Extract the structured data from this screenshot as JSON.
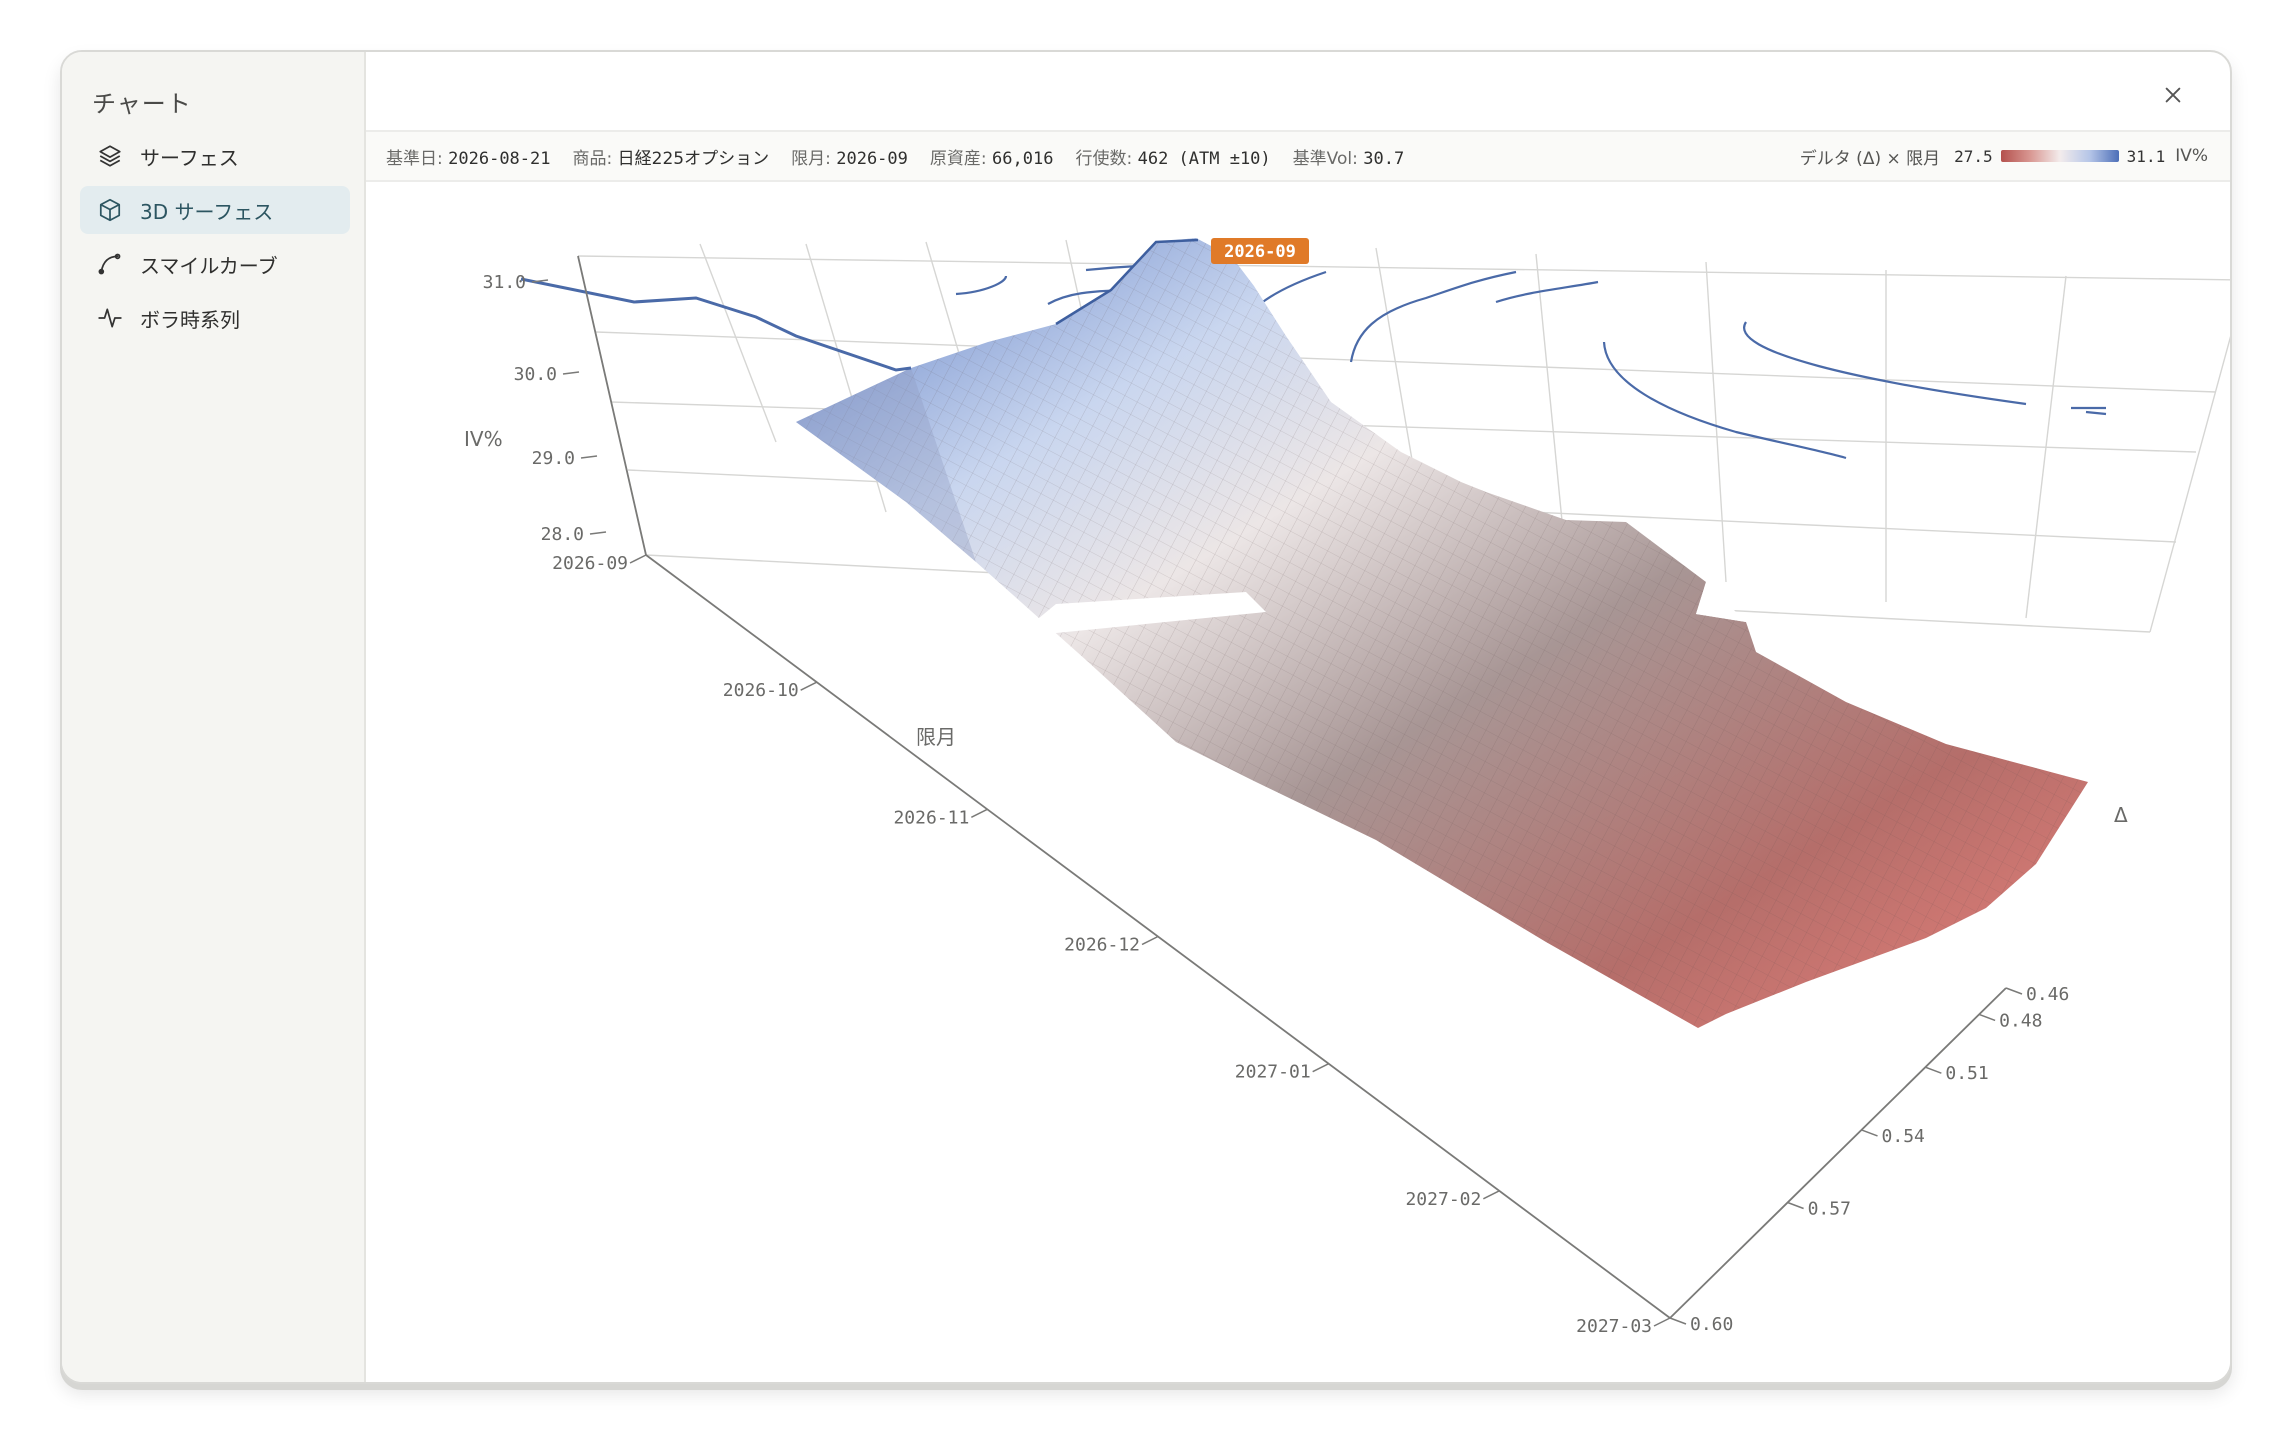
{
  "sidebar": {
    "title": "チャート",
    "items": [
      {
        "label": "サーフェス",
        "icon": "layers-icon"
      },
      {
        "label": "3D サーフェス",
        "icon": "cube-icon",
        "active": true
      },
      {
        "label": "スマイルカーブ",
        "icon": "curve-icon"
      },
      {
        "label": "ボラ時系列",
        "icon": "pulse-icon"
      }
    ]
  },
  "infobar": {
    "base_date_label": "基準日:",
    "base_date": "2026-08-21",
    "product_label": "商品:",
    "product": "日経225オプション",
    "expiry_label": "限月:",
    "expiry": "2026-09",
    "underlying_label": "原資産:",
    "underlying": "66,016",
    "strikes_label": "行使数:",
    "strikes": "462 (ATM ±10)",
    "basevol_label": "基準Vol:",
    "basevol": "30.7"
  },
  "legend": {
    "axes_label": "デルタ (Δ) × 限月",
    "min": "27.5",
    "max": "31.1",
    "unit": "IV%",
    "colors": {
      "low": "#b4514d",
      "mid": "#f3ecec",
      "high": "#4d6fb8"
    }
  },
  "chart_data": {
    "type": "surface",
    "highlight_label": "2026-09",
    "z_axis": {
      "title": "IV%",
      "ticks": [
        "31.0",
        "30.0",
        "29.0",
        "28.0"
      ]
    },
    "x_axis": {
      "title": "限月",
      "ticks": [
        "2026-09",
        "2026-10",
        "2026-11",
        "2026-12",
        "2027-01",
        "2027-02",
        "2027-03"
      ]
    },
    "y_axis": {
      "title": "Δ",
      "ticks": [
        "0.46",
        "0.48",
        "0.51",
        "0.54",
        "0.57",
        "0.60"
      ]
    },
    "zlim": [
      27.5,
      31.1
    ]
  },
  "colors": {
    "accent": "#2c5561",
    "highlight_badge": "#e07a28",
    "contour": "#4a6aa8"
  }
}
